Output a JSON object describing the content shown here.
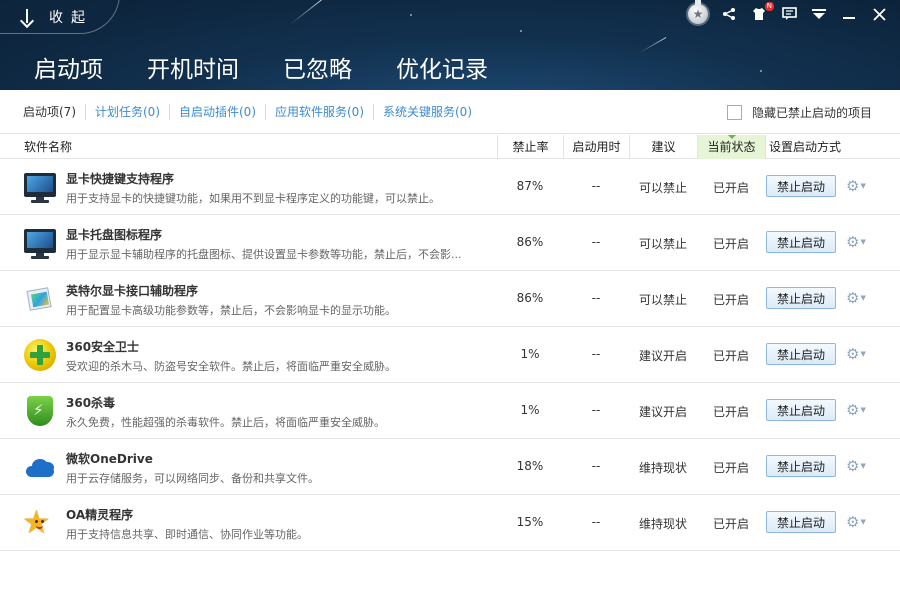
{
  "header": {
    "collapse_label": "收起",
    "tabs": [
      {
        "label": "启动项",
        "active": true
      },
      {
        "label": "开机时间",
        "active": false
      },
      {
        "label": "已忽略",
        "active": false
      },
      {
        "label": "优化记录",
        "active": false
      }
    ],
    "titlebar_icons": [
      "medal-icon",
      "share-icon",
      "skin-icon",
      "message-icon",
      "menu-icon",
      "minimize-icon",
      "close-icon"
    ],
    "skin_badge": "N"
  },
  "subnav": {
    "items": [
      "启动项(7)",
      "计划任务(0)",
      "自启动插件(0)",
      "应用软件服务(0)",
      "系统关键服务(0)"
    ],
    "hide_disabled_label": "隐藏已禁止启动的项目"
  },
  "table": {
    "headers": {
      "name": "软件名称",
      "rate": "禁止率",
      "time": "启动用时",
      "advice": "建议",
      "state": "当前状态",
      "method": "设置启动方式"
    },
    "rows": [
      {
        "icon": "monitor-icon",
        "name": "显卡快捷键支持程序",
        "desc": "用于支持显卡的快捷键功能，如果用不到显卡程序定义的功能键，可以禁止。",
        "rate": "87%",
        "time": "--",
        "advice": "可以禁止",
        "state": "已开启",
        "button": "禁止启动"
      },
      {
        "icon": "monitor-icon",
        "name": "显卡托盘图标程序",
        "desc": "用于显示显卡辅助程序的托盘图标、提供设置显卡参数等功能，禁止后，不会影...",
        "rate": "86%",
        "time": "--",
        "advice": "可以禁止",
        "state": "已开启",
        "button": "禁止启动"
      },
      {
        "icon": "intel-graphics-icon",
        "name": "英特尔显卡接口辅助程序",
        "desc": "用于配置显卡高级功能参数等，禁止后，不会影响显卡的显示功能。",
        "rate": "86%",
        "time": "--",
        "advice": "可以禁止",
        "state": "已开启",
        "button": "禁止启动"
      },
      {
        "icon": "360-safe-icon",
        "name": "360安全卫士",
        "desc": "受欢迎的杀木马、防盗号安全软件。禁止后，将面临严重安全威胁。",
        "rate": "1%",
        "time": "--",
        "advice": "建议开启",
        "state": "已开启",
        "button": "禁止启动"
      },
      {
        "icon": "360-antivirus-icon",
        "name": "360杀毒",
        "desc": "永久免费，性能超强的杀毒软件。禁止后，将面临严重安全威胁。",
        "rate": "1%",
        "time": "--",
        "advice": "建议开启",
        "state": "已开启",
        "button": "禁止启动"
      },
      {
        "icon": "onedrive-cloud-icon",
        "name": "微软OneDrive",
        "desc": "用于云存储服务，可以网络同步、备份和共享文件。",
        "rate": "18%",
        "time": "--",
        "advice": "维持现状",
        "state": "已开启",
        "button": "禁止启动"
      },
      {
        "icon": "oa-star-icon",
        "name": "OA精灵程序",
        "desc": "用于支持信息共享、即时通信、协同作业等功能。",
        "rate": "15%",
        "time": "--",
        "advice": "维持现状",
        "state": "已开启",
        "button": "禁止启动"
      }
    ]
  },
  "colors": {
    "header_bg": "#12314f",
    "link": "#3d8bd3",
    "active_header_bg": "#e5f5d6",
    "button_border": "#8fb8de"
  }
}
